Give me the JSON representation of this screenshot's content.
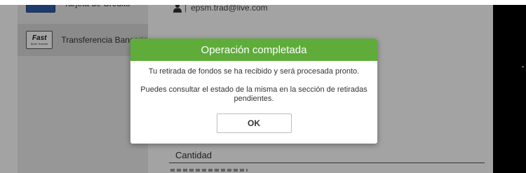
{
  "sidebar": {
    "items": [
      {
        "label": "Tarjeta de Crédito",
        "icon": "credit-card-icon"
      },
      {
        "label": "Transferencia Bancaria",
        "icon": "fast-bank-transfer-icon",
        "icon_text": "Fast",
        "icon_subtext": "Bank Transfer"
      }
    ]
  },
  "account": {
    "email": "epsm.trad@live.com",
    "separator": "|"
  },
  "form": {
    "amount_label": "Cantidad"
  },
  "modal": {
    "title": "Operación completada",
    "message_1": "Tu retirada de fondos se ha recibido y será procesada pronto.",
    "message_2": "Puedes consultar el estado de la misma en la sección de retiradas pendientes.",
    "ok_label": "OK"
  },
  "colors": {
    "modal_header": "#5fac3b",
    "overlay": "rgba(0,0,0,0.36)",
    "sidebar": "#ececec"
  }
}
